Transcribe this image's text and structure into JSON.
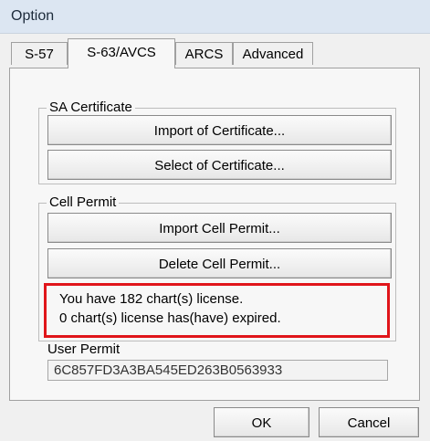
{
  "window": {
    "title": "Option"
  },
  "tabs": [
    {
      "label": "S-57"
    },
    {
      "label": "S-63/AVCS"
    },
    {
      "label": "ARCS"
    },
    {
      "label": "Advanced"
    }
  ],
  "sa_certificate": {
    "label": "SA Certificate",
    "import_label": "Import of Certificate...",
    "select_label": "Select of Certificate..."
  },
  "cell_permit": {
    "label": "Cell Permit",
    "import_label": "Import Cell Permit...",
    "delete_label": "Delete Cell Permit..."
  },
  "license_info": {
    "line1": "You have 182 chart(s) license.",
    "line2": "0 chart(s) license has(have) expired.",
    "highlight_color": "#e0151a"
  },
  "user_permit": {
    "label": "User Permit",
    "value": "6C857FD3A3BA545ED263B0563933"
  },
  "footer": {
    "ok_label": "OK",
    "cancel_label": "Cancel"
  }
}
